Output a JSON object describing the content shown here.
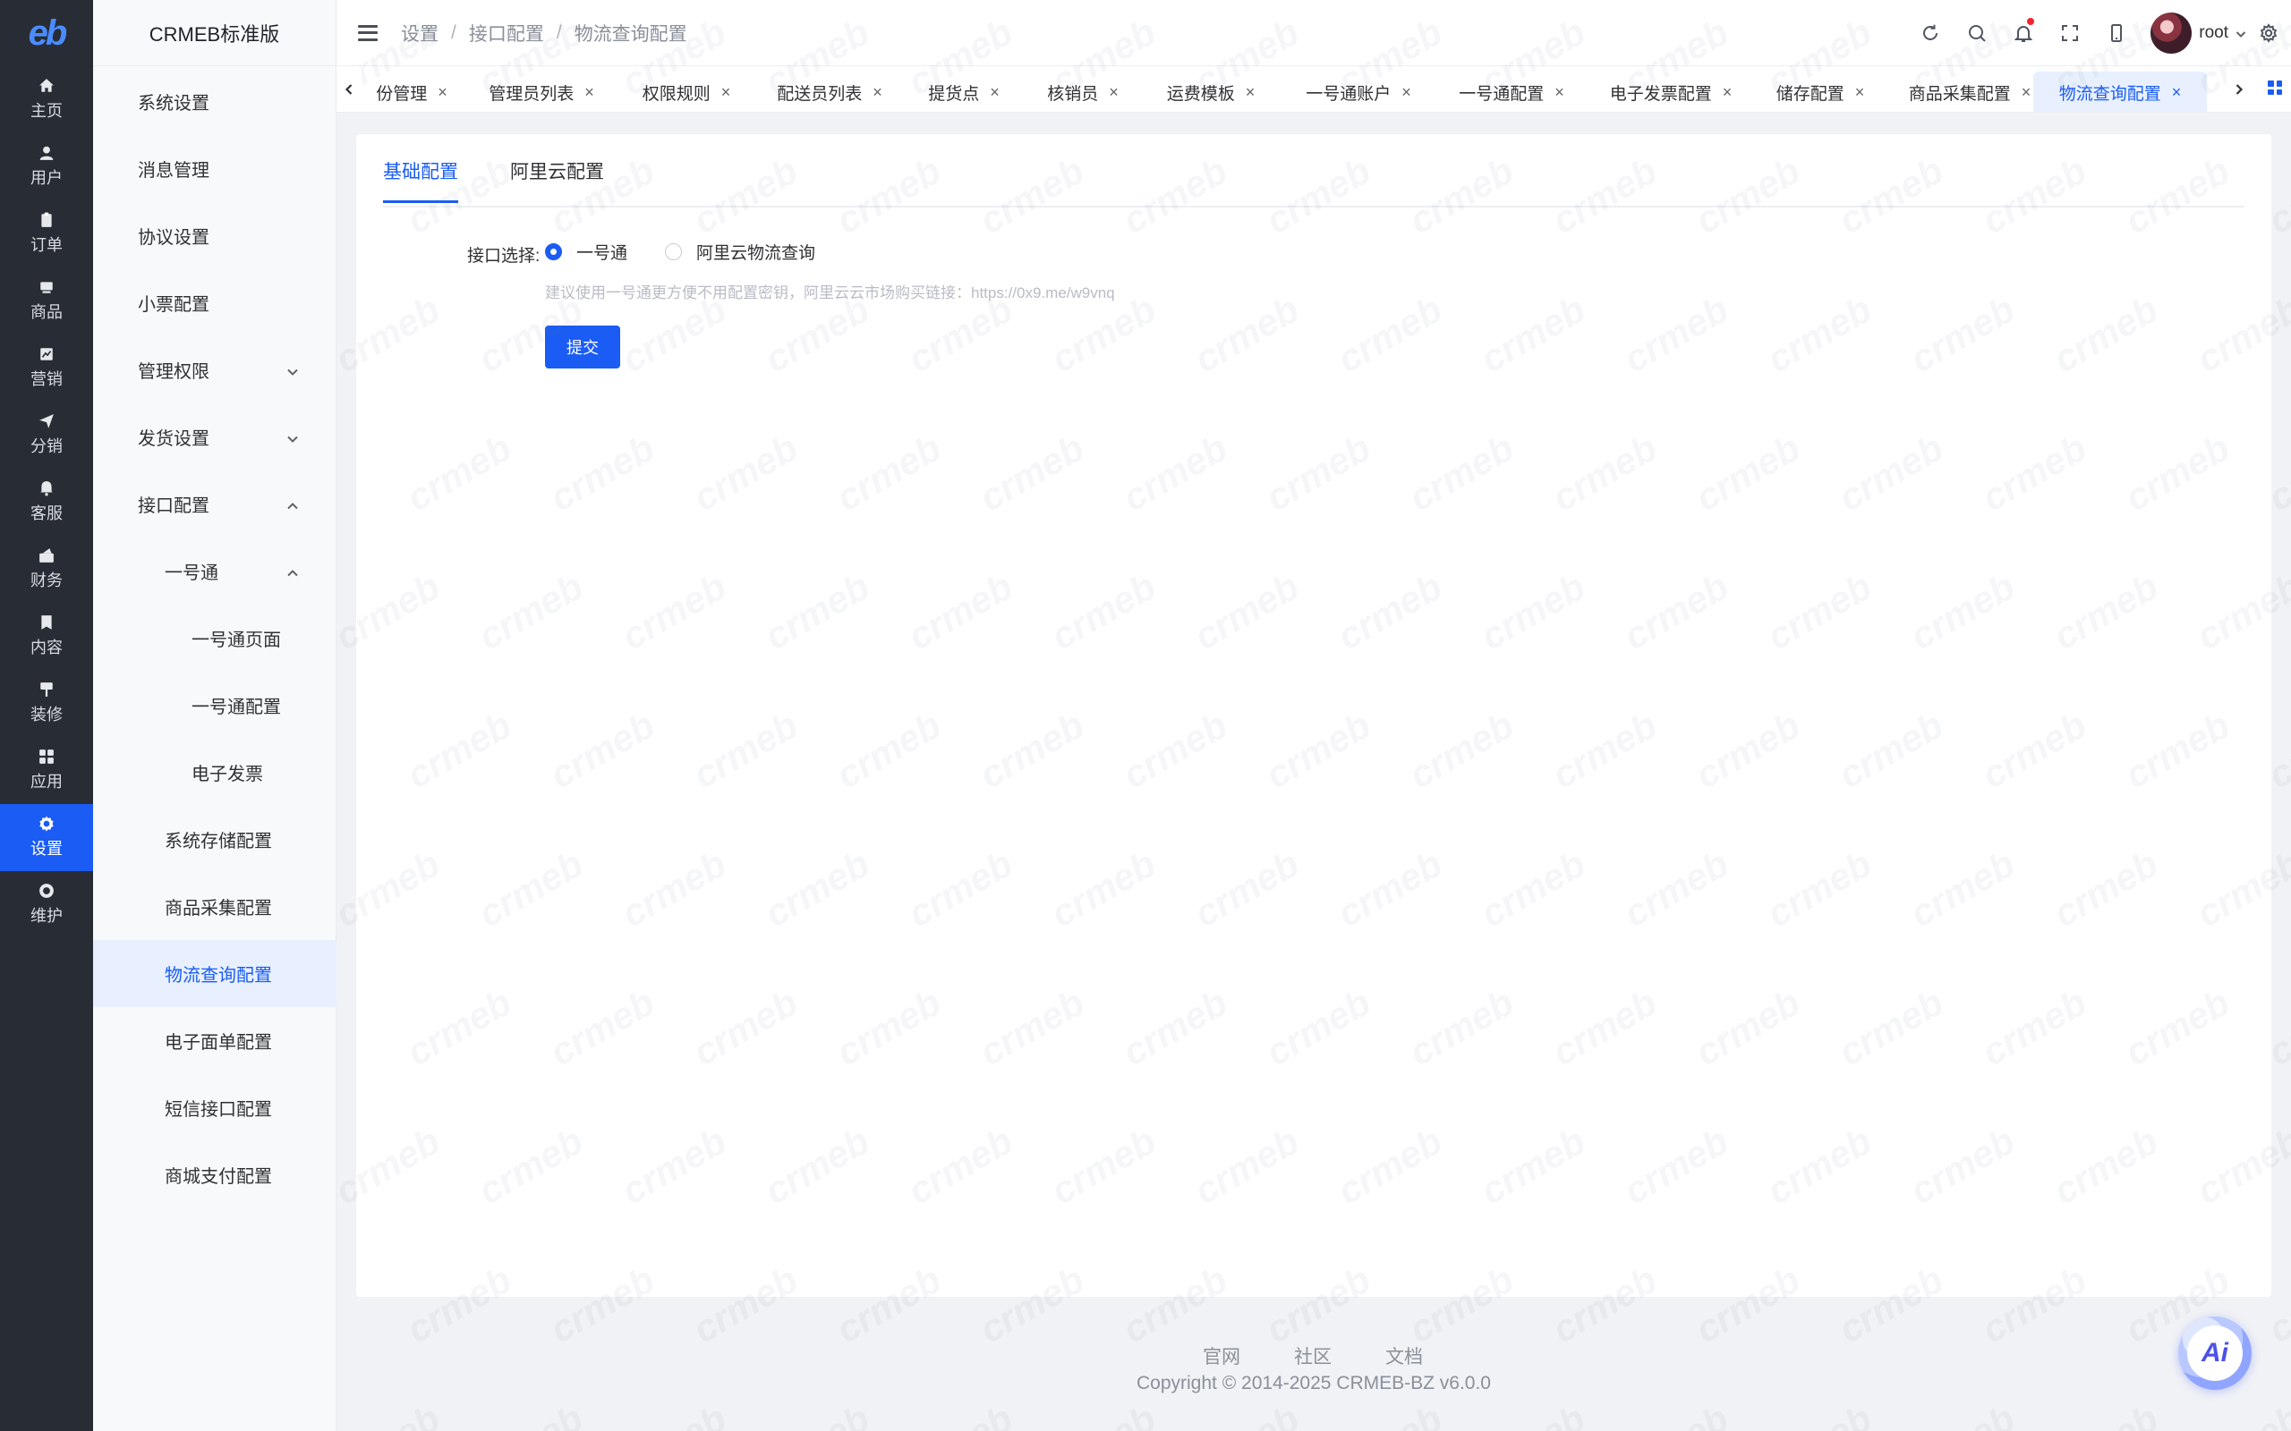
{
  "app": {
    "logo_text": "eb",
    "title": "CRMEB标准版"
  },
  "rail": {
    "items": [
      {
        "label": "主页",
        "icon": "home-icon"
      },
      {
        "label": "用户",
        "icon": "user-icon"
      },
      {
        "label": "订单",
        "icon": "order-icon"
      },
      {
        "label": "商品",
        "icon": "product-icon"
      },
      {
        "label": "营销",
        "icon": "marketing-icon"
      },
      {
        "label": "分销",
        "icon": "distribution-icon"
      },
      {
        "label": "客服",
        "icon": "service-icon"
      },
      {
        "label": "财务",
        "icon": "finance-icon"
      },
      {
        "label": "内容",
        "icon": "content-icon"
      },
      {
        "label": "装修",
        "icon": "decoration-icon"
      },
      {
        "label": "应用",
        "icon": "apps-icon"
      },
      {
        "label": "设置",
        "icon": "settings-icon",
        "active": true
      },
      {
        "label": "维护",
        "icon": "maintenance-icon"
      }
    ]
  },
  "sidebar": {
    "items": [
      {
        "label": "系统设置"
      },
      {
        "label": "消息管理"
      },
      {
        "label": "协议设置"
      },
      {
        "label": "小票配置"
      },
      {
        "label": "管理权限",
        "expand": "down"
      },
      {
        "label": "发货设置",
        "expand": "down"
      },
      {
        "label": "接口配置",
        "expand": "up"
      },
      {
        "label": "一号通",
        "expand": "up"
      },
      {
        "label": "一号通页面"
      },
      {
        "label": "一号通配置"
      },
      {
        "label": "电子发票"
      },
      {
        "label": "系统存储配置"
      },
      {
        "label": "商品采集配置"
      },
      {
        "label": "物流查询配置",
        "active": true
      },
      {
        "label": "电子面单配置"
      },
      {
        "label": "短信接口配置"
      },
      {
        "label": "商城支付配置"
      }
    ]
  },
  "header": {
    "breadcrumb": [
      "设置",
      "接口配置",
      "物流查询配置"
    ],
    "breadcrumb_sep": "/",
    "user_name": "root"
  },
  "tabs": {
    "items": [
      {
        "label": "份管理"
      },
      {
        "label": "管理员列表"
      },
      {
        "label": "权限规则"
      },
      {
        "label": "配送员列表"
      },
      {
        "label": "提货点"
      },
      {
        "label": "核销员"
      },
      {
        "label": "运费模板"
      },
      {
        "label": "一号通账户"
      },
      {
        "label": "一号通配置"
      },
      {
        "label": "电子发票配置"
      },
      {
        "label": "储存配置"
      },
      {
        "label": "商品采集配置"
      },
      {
        "label": "物流查询配置",
        "active": true
      }
    ],
    "close_glyph": "×"
  },
  "main": {
    "tabs": [
      "基础配置",
      "阿里云配置"
    ],
    "form_label": "接口选择:",
    "radio_options": [
      "一号通",
      "阿里云物流查询"
    ],
    "selected": "一号通",
    "hint": "建议使用一号通更方便不用配置密钥，阿里云云市场购买链接：https://0x9.me/w9vnq",
    "submit_label": "提交"
  },
  "footer": {
    "links": [
      "官网",
      "社区",
      "文档"
    ],
    "copyright": "Copyright © 2014-2025 CRMEB-BZ v6.0.0"
  },
  "ai": {
    "label": "Ai"
  },
  "watermark": {
    "text": "crmeb"
  },
  "colors": {
    "accent": "#1a5cf4",
    "rail_bg": "#282c34",
    "active_bg": "#e8f0ff"
  }
}
